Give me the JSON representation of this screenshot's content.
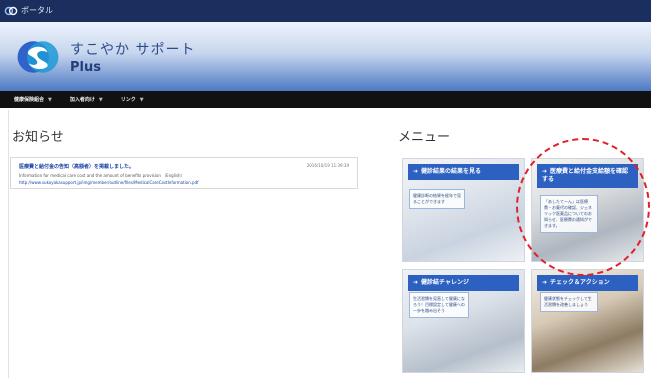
{
  "topbar": {
    "title": "ポータル"
  },
  "header": {
    "brand_name": "すこやか サポート",
    "brand_sub": "Plus"
  },
  "nav": {
    "items": [
      {
        "label": "健康保険組合"
      },
      {
        "label": "加入者向け"
      },
      {
        "label": "リンク"
      }
    ]
  },
  "news": {
    "title": "お知らせ",
    "items": [
      {
        "headline": "医療費と給付金の告知（高額者）を掲載しました。",
        "date": "2016/10/19 11:39:39",
        "description": "Information for medical care cost and the amount of benefits provision （English）",
        "url": "http://www.sukoyakasupport.jp/img/member/outline/files/MedicalCareCostInformation.pdf"
      }
    ]
  },
  "menu": {
    "title": "メニュー",
    "tiles": [
      {
        "label": "健診結果の結果を見る",
        "text": "健康診断の結果を経年で見ることができます"
      },
      {
        "label": "医療費と給付金支給額を確認する",
        "text": "「あしたてーん」は医療費・お薬代の確認、ジェネリック医薬品についてのお知らせ、医療費の通知ができます。"
      },
      {
        "label": "健診結チャレンジ",
        "text": "生活習慣を見直して健康になろう！目標設定して健康への一歩を踏み出そう"
      },
      {
        "label": "チェック＆アクション",
        "text": "健康状態をチェックして生活習慣を改善しましょう"
      }
    ]
  },
  "colors": {
    "accent": "#2c61c2",
    "nav_bg": "#111111",
    "highlight": "#e0202a"
  }
}
